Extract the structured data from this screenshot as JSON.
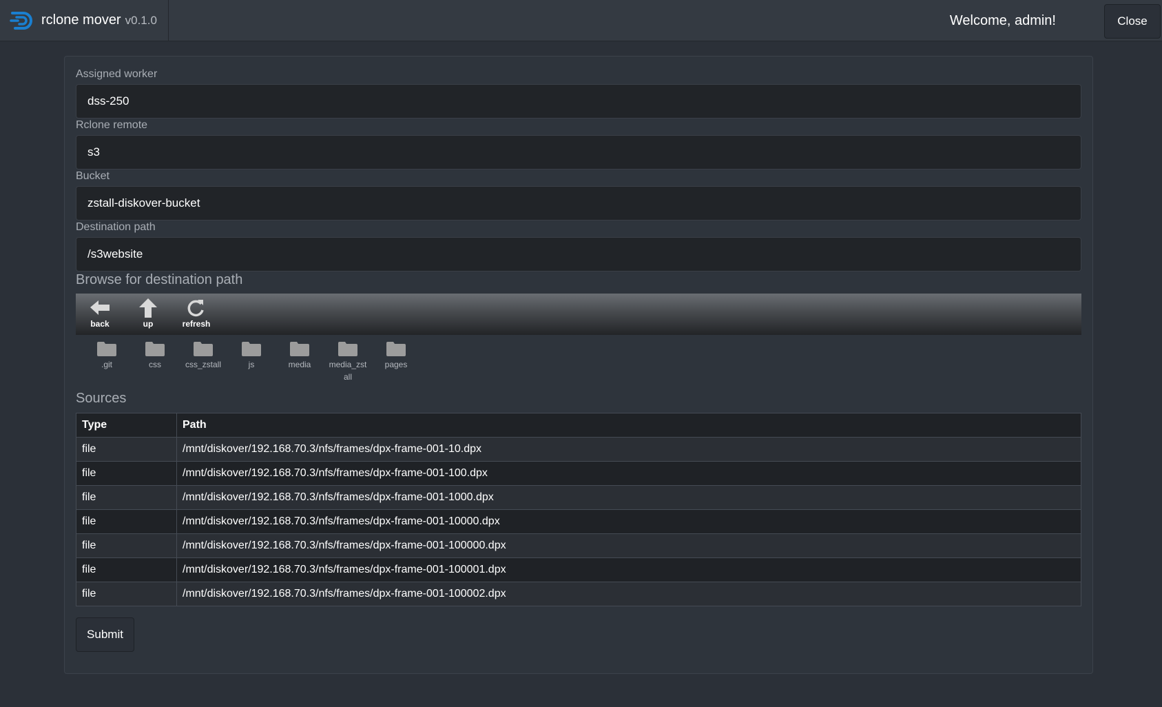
{
  "header": {
    "app_name": "rclone mover",
    "version": "v0.1.0",
    "welcome": "Welcome, admin!",
    "close_label": "Close",
    "logo_icon": "diskover-logo-icon",
    "accent_color": "#1a7fd0"
  },
  "form": {
    "assigned_worker": {
      "label": "Assigned worker",
      "value": "dss-250"
    },
    "rclone_remote": {
      "label": "Rclone remote",
      "value": "s3"
    },
    "bucket": {
      "label": "Bucket",
      "value": "zstall-diskover-bucket"
    },
    "destination_path": {
      "label": "Destination path",
      "value": "/s3website"
    }
  },
  "browser": {
    "title": "Browse for destination path",
    "toolbar": [
      {
        "label": "back",
        "icon": "arrow-left-icon"
      },
      {
        "label": "up",
        "icon": "arrow-up-icon"
      },
      {
        "label": "refresh",
        "icon": "refresh-icon"
      }
    ],
    "folders": [
      ".git",
      "css",
      "css_zstall",
      "js",
      "media",
      "media_zstall",
      "pages"
    ]
  },
  "sources": {
    "title": "Sources",
    "columns": [
      "Type",
      "Path"
    ],
    "rows": [
      {
        "type": "file",
        "path": "/mnt/diskover/192.168.70.3/nfs/frames/dpx-frame-001-10.dpx"
      },
      {
        "type": "file",
        "path": "/mnt/diskover/192.168.70.3/nfs/frames/dpx-frame-001-100.dpx"
      },
      {
        "type": "file",
        "path": "/mnt/diskover/192.168.70.3/nfs/frames/dpx-frame-001-1000.dpx"
      },
      {
        "type": "file",
        "path": "/mnt/diskover/192.168.70.3/nfs/frames/dpx-frame-001-10000.dpx"
      },
      {
        "type": "file",
        "path": "/mnt/diskover/192.168.70.3/nfs/frames/dpx-frame-001-100000.dpx"
      },
      {
        "type": "file",
        "path": "/mnt/diskover/192.168.70.3/nfs/frames/dpx-frame-001-100001.dpx"
      },
      {
        "type": "file",
        "path": "/mnt/diskover/192.168.70.3/nfs/frames/dpx-frame-001-100002.dpx"
      }
    ]
  },
  "submit_label": "Submit"
}
